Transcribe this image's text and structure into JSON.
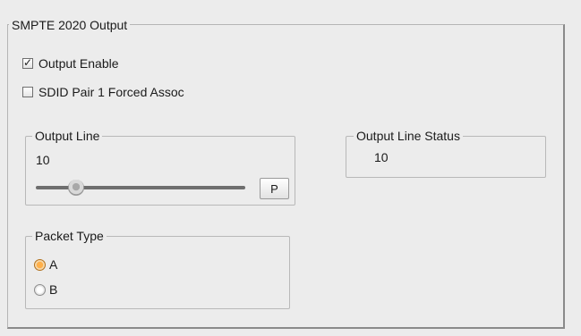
{
  "panel": {
    "title": "SMPTE 2020 Output"
  },
  "output_enable": {
    "label": "Output Enable",
    "checked": true
  },
  "sdid_pair": {
    "label": "SDID Pair 1 Forced Assoc",
    "checked": false
  },
  "output_line": {
    "title": "Output Line",
    "value": "10",
    "preset_button_label": "P"
  },
  "output_line_status": {
    "title": "Output Line Status",
    "value": "10"
  },
  "packet_type": {
    "title": "Packet Type",
    "options": [
      "A",
      "B"
    ],
    "selected": "A"
  },
  "icons": {
    "check": "checkmark-icon"
  },
  "colors": {
    "panel_background": "#ececec",
    "radio_selected": "#ffb04a"
  }
}
